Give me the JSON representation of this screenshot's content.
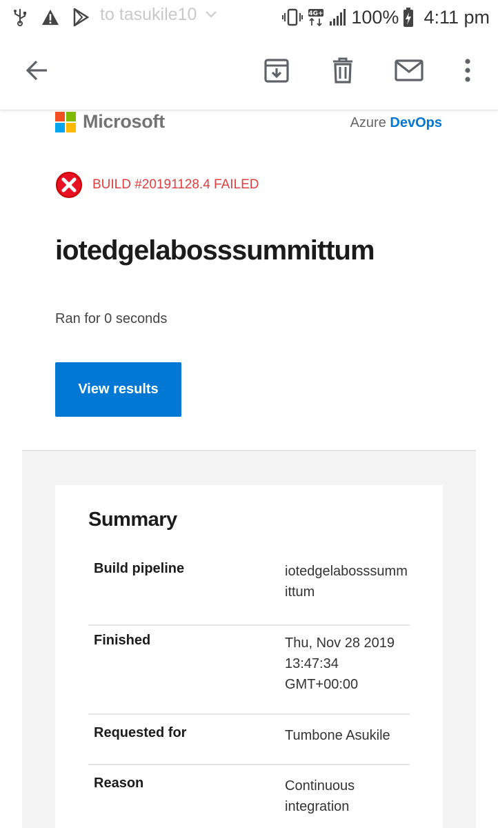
{
  "status_bar": {
    "ghost_text": "to tasukile10",
    "network_label": "4G+",
    "battery_percent": "100%",
    "time": "4:11 pm"
  },
  "app_bar": {
    "actions": [
      "back-icon",
      "archive-icon",
      "delete-icon",
      "mark-unread-icon",
      "more-vert-icon"
    ]
  },
  "email": {
    "brand": "Microsoft",
    "product_prefix": "Azure",
    "product_name": "DevOps",
    "build_status": "BUILD #20191128.4 FAILED",
    "title": "iotedgelabosssummittum",
    "duration": "Ran for 0 seconds",
    "view_results_label": "View results",
    "summary": {
      "heading": "Summary",
      "rows": [
        {
          "label": "Build pipeline",
          "value": "iotedgelabosssummittum"
        },
        {
          "label": "Finished",
          "value": "Thu, Nov 28 2019 13:47:34 GMT+00:00"
        },
        {
          "label": "Requested for",
          "value": "Tumbone Asukile"
        },
        {
          "label": "Reason",
          "value": "Continuous integration"
        }
      ]
    }
  },
  "colors": {
    "azure_blue": "#0078d4",
    "fail_red": "#e03e3e",
    "ms_red": "#f25022",
    "ms_green": "#7fba00",
    "ms_blue": "#00a4ef",
    "ms_yellow": "#ffb900"
  }
}
